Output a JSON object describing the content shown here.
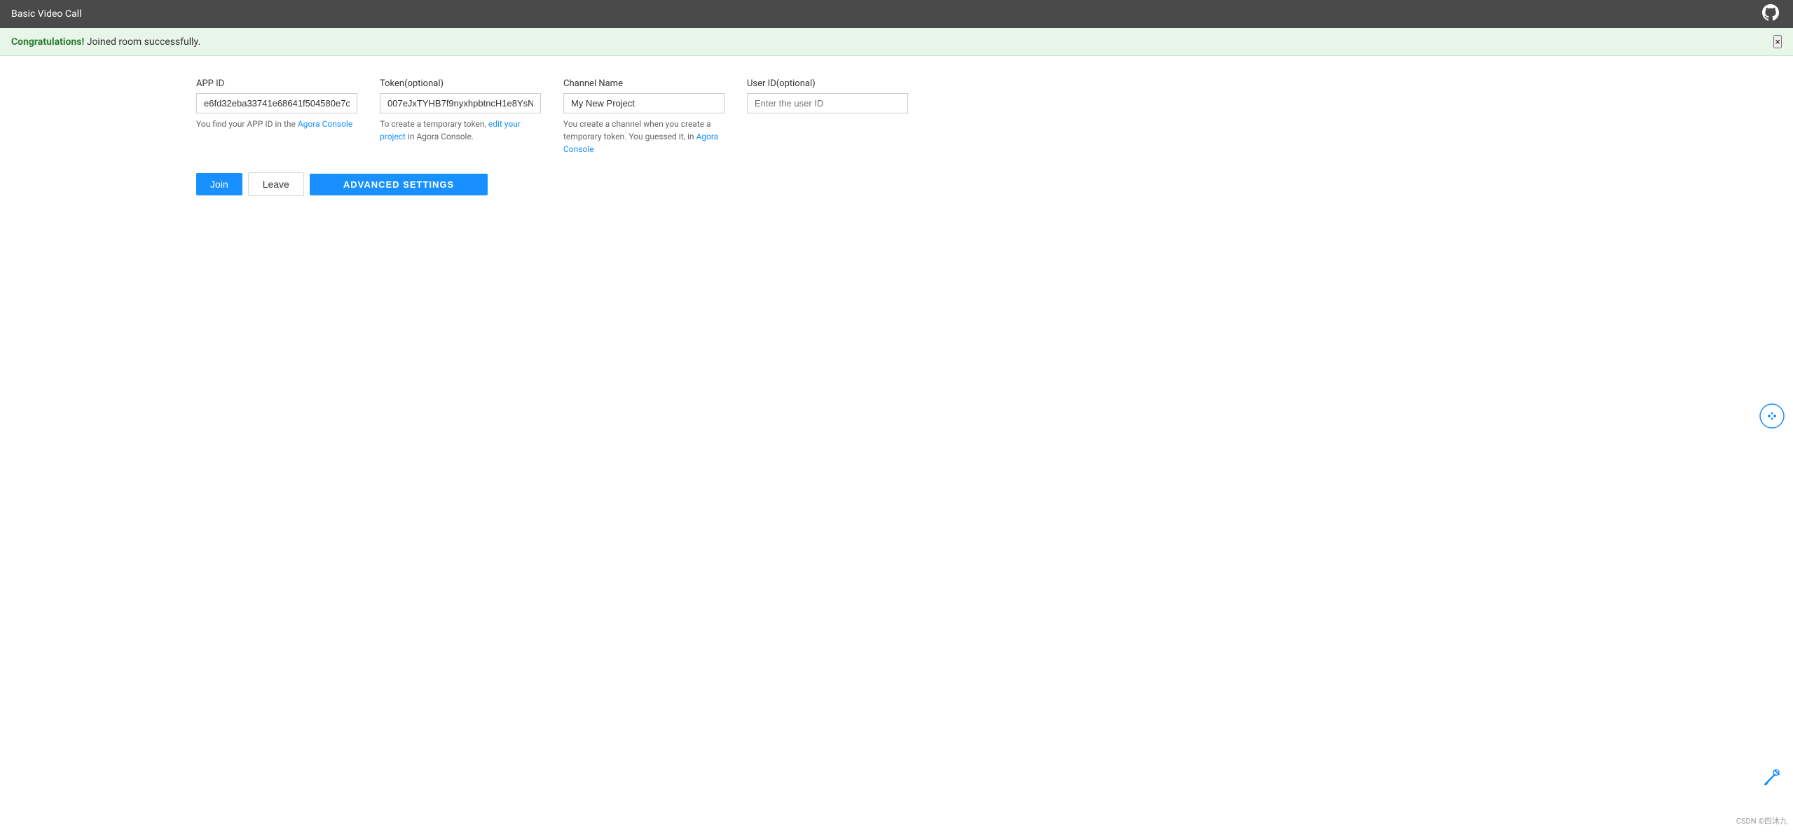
{
  "titlebar": {
    "title": "Basic Video Call",
    "github_icon": "github-icon"
  },
  "banner": {
    "bold_text": "Congratulations!",
    "message": " Joined room successfully.",
    "close_label": "×"
  },
  "fields": {
    "app_id": {
      "label": "APP ID",
      "value": "e6fd32eba33741e68641f504580e7c",
      "placeholder": "",
      "hint_prefix": "You find your APP ID in the ",
      "hint_link_text": "Agora Console",
      "hint_link_url": "#"
    },
    "token": {
      "label": "Token(optional)",
      "value": "007eJxTYHB7f9nyxhpbtncH1e8YsN",
      "placeholder": "",
      "hint_prefix": "To create a temporary token, ",
      "hint_link_text": "edit your project",
      "hint_link_url": "#",
      "hint_suffix": " in Agora Console."
    },
    "channel": {
      "label": "Channel Name",
      "value": "My New Project",
      "placeholder": "",
      "hint_prefix": "You create a channel when you create a temporary token. You guessed it, in ",
      "hint_link_text": "Agora Console",
      "hint_link_url": "#"
    },
    "user_id": {
      "label": "User ID(optional)",
      "value": "",
      "placeholder": "Enter the user ID"
    }
  },
  "buttons": {
    "join_label": "Join",
    "leave_label": "Leave",
    "advanced_label": "ADVANCED SETTINGS"
  },
  "footer": {
    "text": "CSDN ©四沐九"
  }
}
